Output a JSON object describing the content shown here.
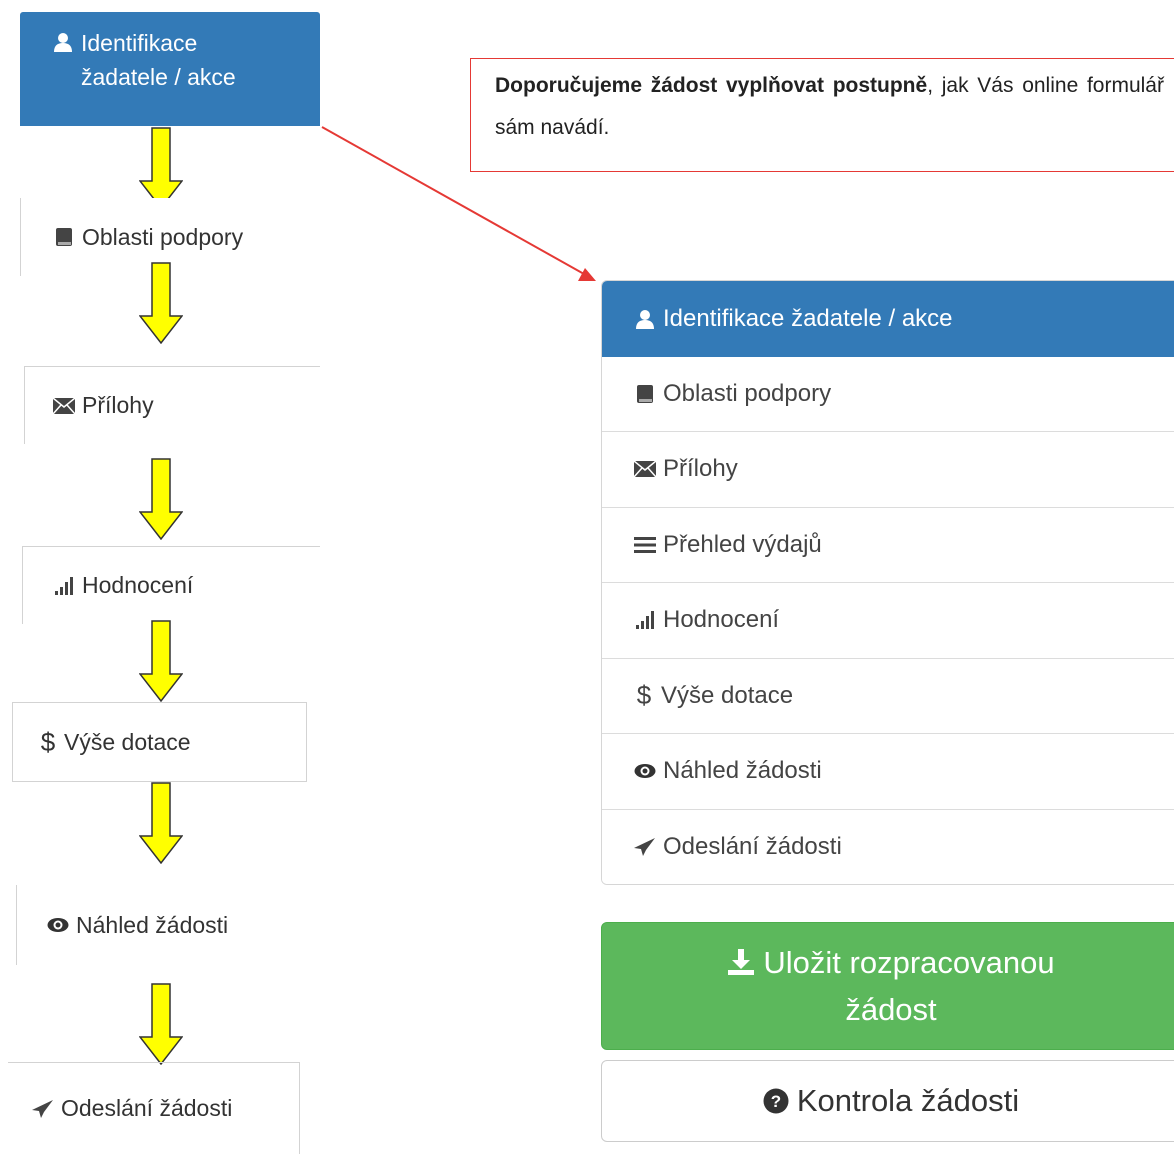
{
  "callout": {
    "bold_text": "Doporučujeme žádost vyplňovat postupně",
    "rest_text": ", jak Vás online formulář sám navádí."
  },
  "flow": {
    "step1_line1": "Identifikace",
    "step1_line2": "žadatele / akce",
    "step2": "Oblasti podpory",
    "step3": "Přílohy",
    "step4": "Hodnocení",
    "step5": "Výše dotace",
    "step6": "Náhled žádosti",
    "step7": "Odeslání žádosti"
  },
  "menu": {
    "items": [
      {
        "label": "Identifikace žadatele / akce",
        "icon": "user-icon"
      },
      {
        "label": "Oblasti podpory",
        "icon": "book-icon"
      },
      {
        "label": "Přílohy",
        "icon": "envelope-icon"
      },
      {
        "label": "Přehled výdajů",
        "icon": "list-icon"
      },
      {
        "label": "Hodnocení",
        "icon": "signal-icon"
      },
      {
        "label": "Výše dotace",
        "icon": "dollar-icon"
      },
      {
        "label": "Náhled žádosti",
        "icon": "eye-icon"
      },
      {
        "label": "Odeslání žádosti",
        "icon": "send-icon"
      }
    ]
  },
  "buttons": {
    "save_line1": "Uložit rozpracovanou",
    "save_line2": "žádost",
    "check": "Kontrola žádosti"
  },
  "colors": {
    "active": "#337ab7",
    "save": "#5cb85c",
    "arrow_fill": "#ffff00",
    "callout_border": "#e53935"
  }
}
